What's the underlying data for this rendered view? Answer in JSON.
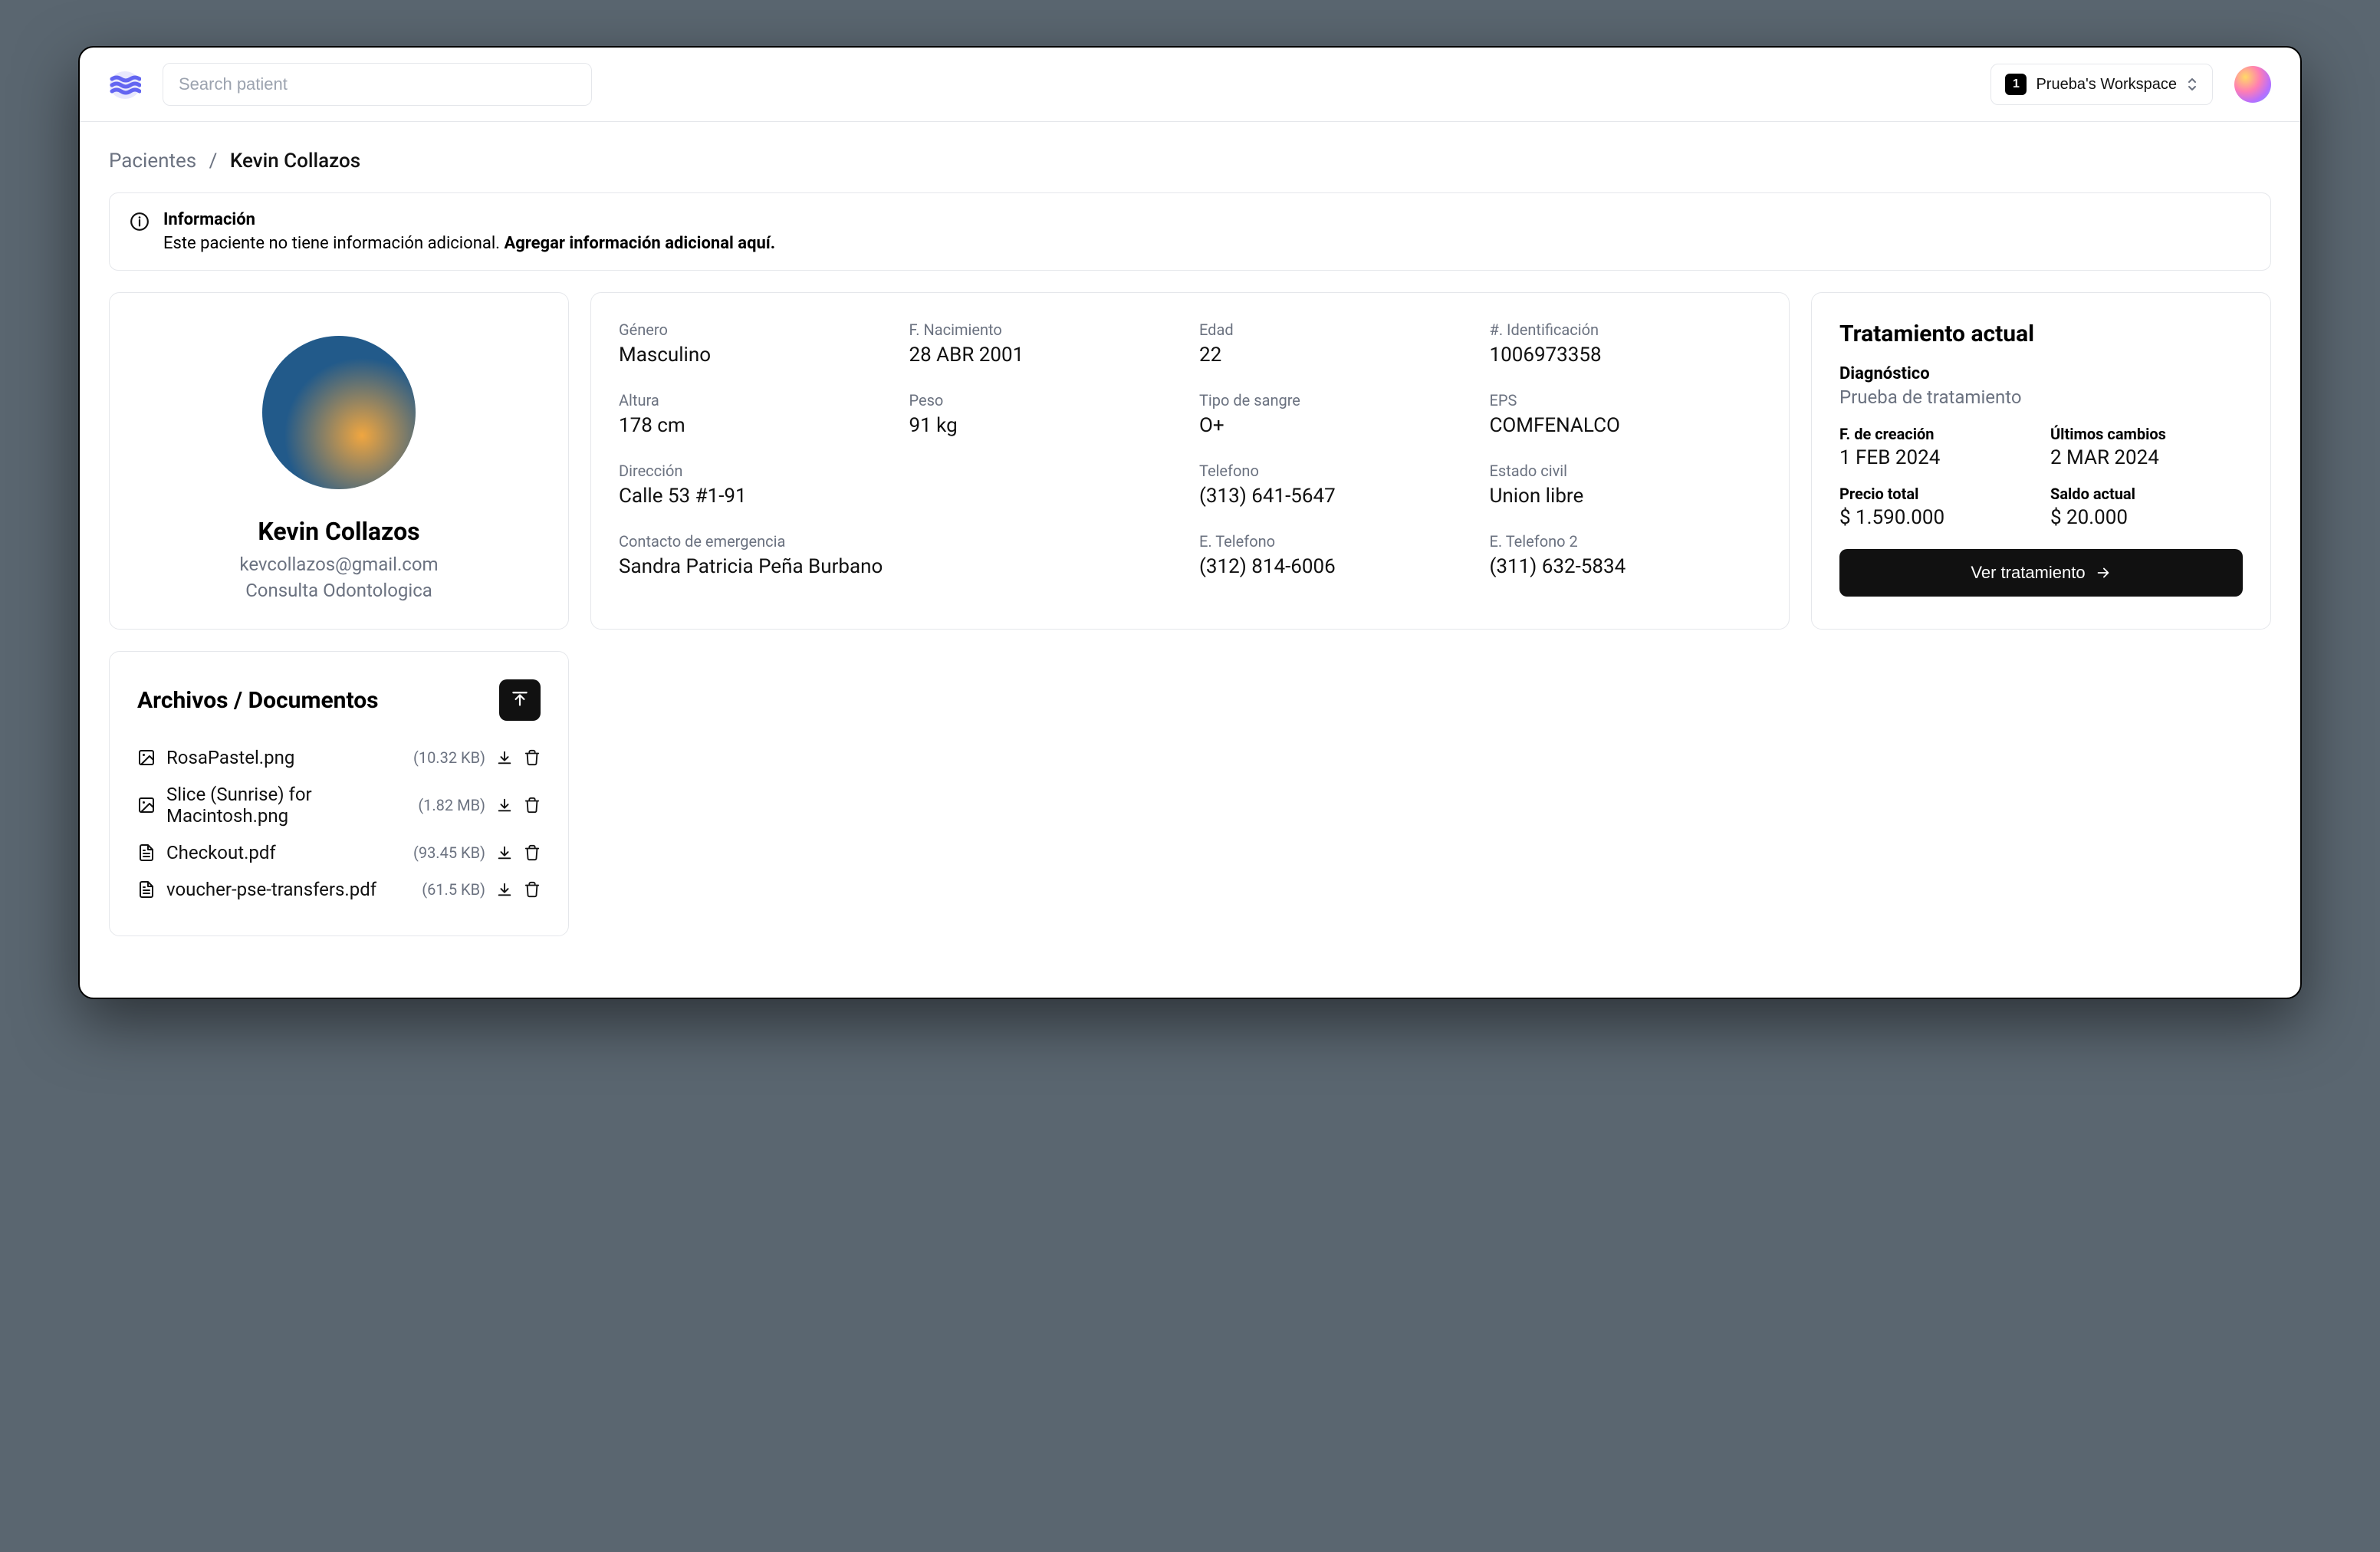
{
  "header": {
    "search_placeholder": "Search patient",
    "workspace_badge": "1",
    "workspace_name": "Prueba's Workspace"
  },
  "breadcrumb": {
    "root": "Pacientes",
    "current": "Kevin Collazos"
  },
  "alert": {
    "title": "Información",
    "text": "Este paciente no tiene información adicional. ",
    "link": "Agregar información adicional aquí."
  },
  "profile": {
    "name": "Kevin Collazos",
    "email": "kevcollazos@gmail.com",
    "type": "Consulta Odontologica"
  },
  "details": {
    "gender_label": "Género",
    "gender": "Masculino",
    "dob_label": "F. Nacimiento",
    "dob": "28 ABR 2001",
    "age_label": "Edad",
    "age": "22",
    "id_label": "#. Identificación",
    "id": "1006973358",
    "height_label": "Altura",
    "height": "178 cm",
    "weight_label": "Peso",
    "weight": "91 kg",
    "blood_label": "Tipo de sangre",
    "blood": "O+",
    "eps_label": "EPS",
    "eps": "COMFENALCO",
    "addr_label": "Dirección",
    "addr": "Calle 53 #1-91",
    "phone_label": "Telefono",
    "phone": "(313) 641-5647",
    "civil_label": "Estado civil",
    "civil": "Union libre",
    "emerg_label": "Contacto de emergencia",
    "emerg": "Sandra Patricia Peña Burbano",
    "ephone1_label": "E. Telefono",
    "ephone1": "(312) 814-6006",
    "ephone2_label": "E. Telefono 2",
    "ephone2": "(311) 632-5834"
  },
  "treatment": {
    "title": "Tratamiento actual",
    "diag_label": "Diagnóstico",
    "diag": "Prueba de tratamiento",
    "created_label": "F. de creación",
    "created": "1 FEB 2024",
    "updated_label": "Últimos cambios",
    "updated": "2 MAR 2024",
    "total_label": "Precio total",
    "total": "$ 1.590.000",
    "balance_label": "Saldo actual",
    "balance": "$ 20.000",
    "button": "Ver tratamiento"
  },
  "files": {
    "title": "Archivos / Documentos",
    "items": [
      {
        "name": "RosaPastel.png",
        "size": "(10.32 KB)",
        "type": "image"
      },
      {
        "name": "Slice (Sunrise) for Macintosh.png",
        "size": "(1.82 MB)",
        "type": "image"
      },
      {
        "name": "Checkout.pdf",
        "size": "(93.45 KB)",
        "type": "doc"
      },
      {
        "name": "voucher-pse-transfers.pdf",
        "size": "(61.5 KB)",
        "type": "doc"
      }
    ]
  }
}
